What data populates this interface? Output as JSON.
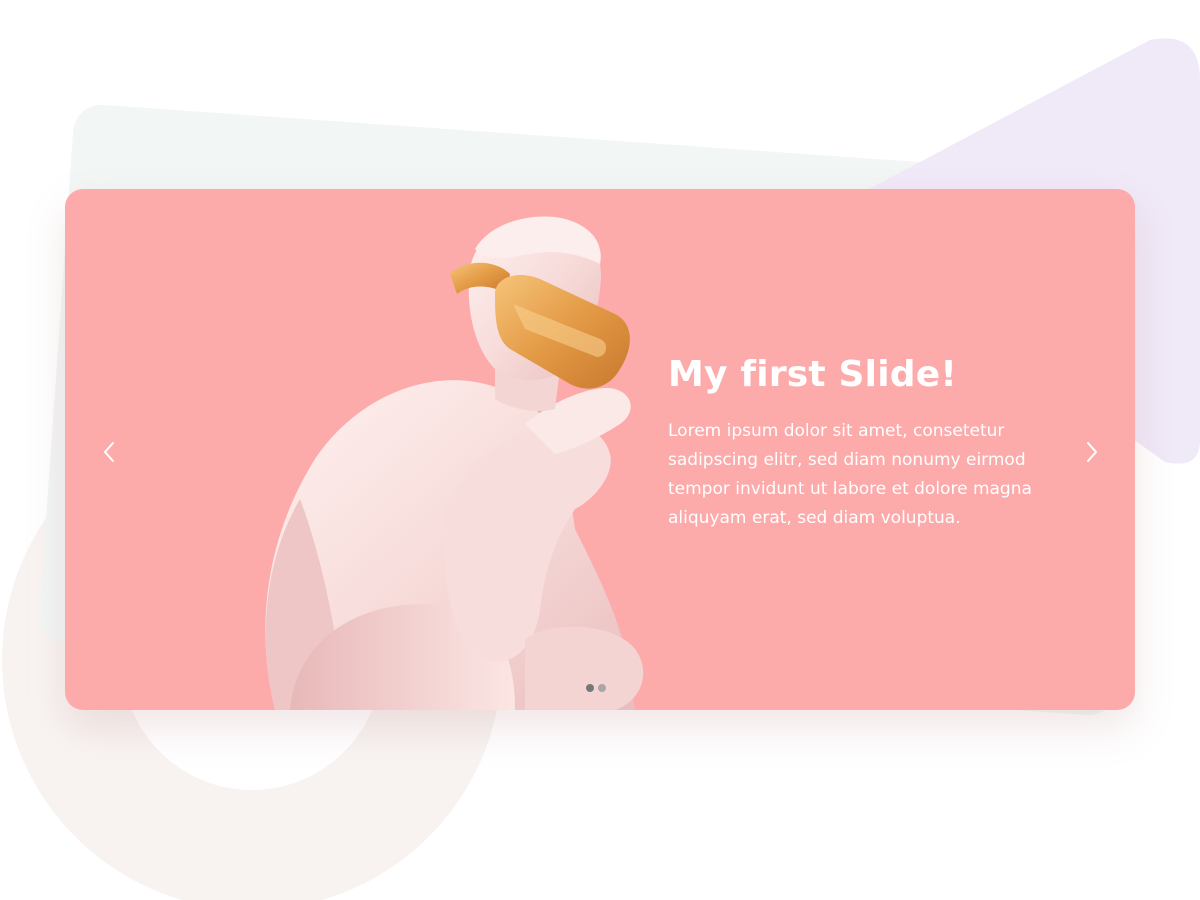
{
  "slide": {
    "title": "My first Slide!",
    "body": "Lorem ipsum dolor sit amet, consetetur sadipscing elitr, sed diam nonumy eirmod tempor invidunt ut labore et dolore magna aliquyam erat, sed diam voluptua."
  },
  "slider": {
    "active_slide": 1,
    "slide_count": 2
  },
  "icons": {
    "prev": "chevron-left-icon",
    "next": "chevron-right-icon",
    "image": "statue-with-vr-headset"
  },
  "colors": {
    "slide_background": "#fdaaaa",
    "text": "#ffffff",
    "dot_active": "#777777",
    "dot_inactive": "#a7a7a7",
    "headset": "#e09a46",
    "decor_triangle": "#f0e9f8",
    "decor_card": "#f2f6f5",
    "decor_ring": "#f8f3f1"
  }
}
